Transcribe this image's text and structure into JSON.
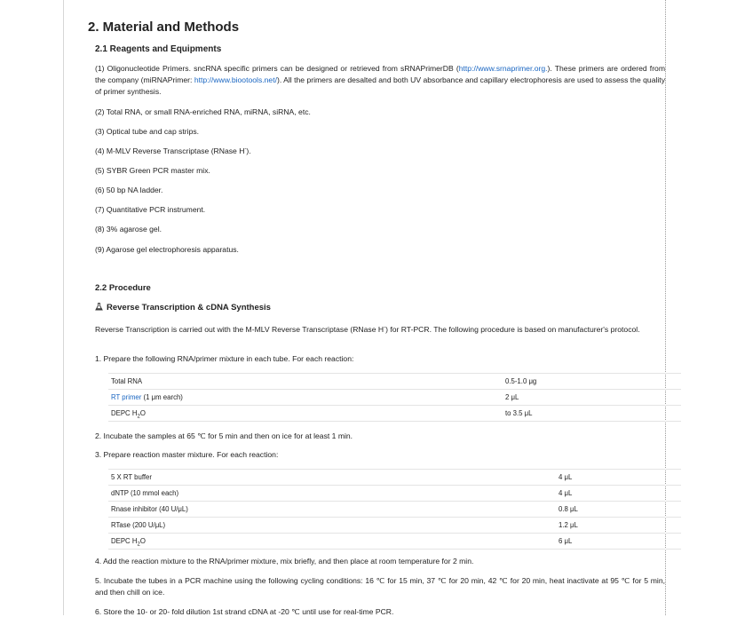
{
  "section_title": "2. Material and Methods",
  "reagents": {
    "heading": "2.1 Reagents and Equipments",
    "item1_a": "(1) Oligonucleotide Primers. sncRNA specific primers can be designed or retrieved from sRNAPrimerDB (",
    "item1_link1": "http://www.srnaprimer.org.",
    "item1_b": "). These primers are ordered from the company (miRNAPrimer: ",
    "item1_link2": "http://www.biootools.net/",
    "item1_c": "). All the primers are desalted and both UV absorbance and capillary electrophoresis are used to assess the quality of primer synthesis.",
    "items": [
      "(2) Total RNA, or small RNA-enriched RNA, miRNA, siRNA, etc.",
      "(3) Optical tube and cap strips.",
      "(4) M-MLV Reverse Transcriptase (RNase H",
      "(5) SYBR Green PCR master mix.",
      "(6) 50 bp NA ladder.",
      "(7) Quantitative PCR instrument.",
      "(8) 3% agarose gel.",
      "(9) Agarose gel electrophoresis apparatus."
    ],
    "item4_sup": "-",
    "item4_end": ")."
  },
  "procedure": {
    "heading": "2.2 Procedure",
    "sub_heading": "Reverse Transcription & cDNA Synthesis",
    "intro_a": "Reverse Transcription is carried out with the M-MLV Reverse Transcriptase (RNase H",
    "intro_sup": "-",
    "intro_b": ") for RT-PCR. The following procedure is based on manufacturer's protocol.",
    "step1": "1. Prepare the following RNA/primer mixture in each tube. For each reaction:",
    "table1": [
      {
        "name": "Total RNA",
        "value": "0.5-1.0 μg"
      },
      {
        "name_link": "RT primer",
        "name_rest": " (1 μm earch)",
        "value": "2 μL"
      },
      {
        "name": "DEPC H",
        "name_sub": "2",
        "name_end": "O",
        "value": "to 3.5 μL"
      }
    ],
    "step2": "2. Incubate the samples at 65 ℃ for 5 min and then on ice for at least 1 min.",
    "step3": "3. Prepare reaction master mixture. For each reaction:",
    "table2": [
      {
        "name": "5 X RT buffer",
        "value": "4 μL"
      },
      {
        "name": "dNTP (10 mmol each)",
        "value": "4 μL"
      },
      {
        "name": "Rnase inhibitor (40 U/μL)",
        "value": "0.8 μL"
      },
      {
        "name": "RTase (200 U/μL)",
        "value": "1.2 μL"
      },
      {
        "name": "DEPC H",
        "name_sub": "2",
        "name_end": "O",
        "value": "6 μL"
      }
    ],
    "step4": "4. Add the reaction mixture to the RNA/primer mixture, mix briefly, and then place at room temperature for 2 min.",
    "step5": "5. Incubate the tubes in a PCR machine using the following cycling conditions: 16 ℃ for 15 min, 37 ℃ for 20 min, 42 ℃ for 20 min, heat inactivate at 95 ℃ for 5 min, and then chill on ice.",
    "step6": "6. Store the 10- or 20- fold dilution 1st strand cDNA at -20 ℃ until use for real-time PCR."
  },
  "colors": {
    "link": "#1a66c2",
    "text": "#222222",
    "rule": "#e4e4e4"
  },
  "icons": {
    "procedure_icon": "flask-icon"
  }
}
